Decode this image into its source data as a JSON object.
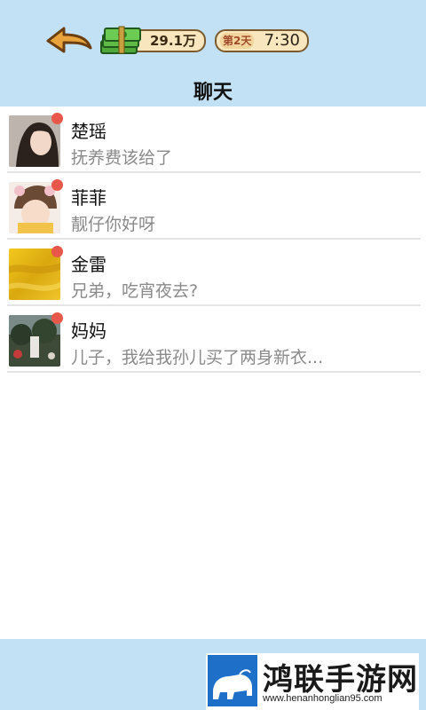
{
  "header": {
    "money": "29.1万",
    "day": "第2天",
    "clock": "7:30",
    "title": "聊天"
  },
  "chats": [
    {
      "name": "楚瑶",
      "preview": "抚养费该给了",
      "avatar": "woman-photo",
      "unread": true
    },
    {
      "name": "菲菲",
      "preview": "靓仔你好呀",
      "avatar": "girl-photo",
      "unread": true
    },
    {
      "name": "金雷",
      "preview": "兄弟，吃宵夜去?",
      "avatar": "gold-texture",
      "unread": true
    },
    {
      "name": "妈妈",
      "preview": "儿子，我给我孙儿买了两身新衣...",
      "avatar": "garden-photo",
      "unread": true
    }
  ],
  "watermark": {
    "title": "鸿联手游网",
    "url": "www.henanhonglian95.com"
  },
  "colors": {
    "header_bg": "#c3e1f5",
    "unread_dot": "#e8574a",
    "pill_bg": "#f7e6be"
  },
  "icons": [
    "back-arrow-icon",
    "cash-icon",
    "bison-logo-icon"
  ]
}
